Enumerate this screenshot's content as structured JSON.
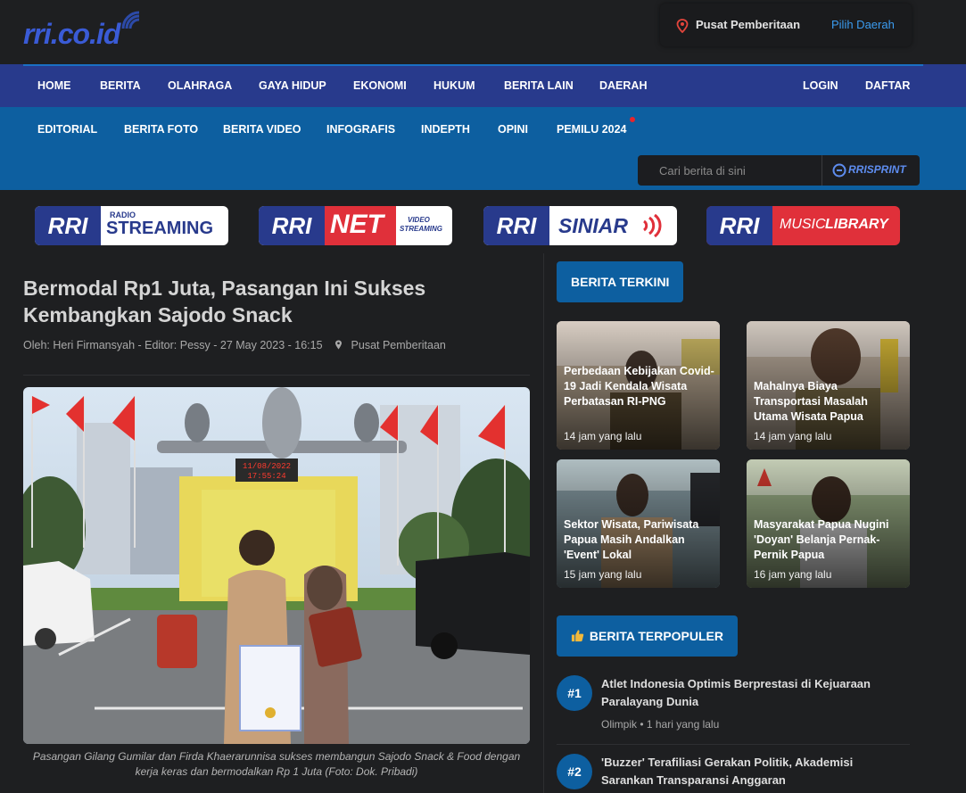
{
  "logo": {
    "text": "rri.co.id"
  },
  "region": {
    "label": "Pusat Pemberitaan",
    "pick": "Pilih Daerah"
  },
  "nav_primary": [
    "HOME",
    "BERITA",
    "OLAHRAGA",
    "GAYA HIDUP",
    "EKONOMI",
    "HUKUM",
    "BERITA LAIN",
    "DAERAH"
  ],
  "nav_account": {
    "login": "LOGIN",
    "register": "DAFTAR"
  },
  "nav_secondary": [
    "EDITORIAL",
    "BERITA FOTO",
    "BERITA VIDEO",
    "INFOGRAFIS",
    "INDEPTH",
    "OPINI",
    "PEMILU 2024"
  ],
  "search": {
    "placeholder": "Cari berita di sini",
    "sprint_label": "RRISPRINT"
  },
  "banners": [
    {
      "brand": "RRI",
      "small": "RADIO",
      "main": "STREAMING"
    },
    {
      "brand": "RRI",
      "main": "NET",
      "small1": "VIDEO",
      "small2": "STREAMING"
    },
    {
      "brand": "RRI",
      "main": "SINIAR"
    },
    {
      "brand": "RRI",
      "main_a": "MUSIC",
      "main_b": "LIBRARY"
    }
  ],
  "article": {
    "title": "Bermodal Rp1 Juta, Pasangan Ini Sukses Kembangkan Sajodo Snack",
    "byline": "Oleh: Heri Firmansyah - Editor: Pessy - 27 May 2023 - 16:15",
    "location": "Pusat Pemberitaan",
    "photo_sign_date": "11/08/2022",
    "photo_sign_time": "17:55:24",
    "caption": "Pasangan Gilang Gumilar dan Firda Khaerarunnisa sukses membangun Sajodo Snack & Food dengan kerja keras dan bermodalkan Rp 1 Juta (Foto: Dok. Pribadi)"
  },
  "latest": {
    "heading": "BERITA TERKINI",
    "items": [
      {
        "title": "Perbedaan Kebijakan Covid-19 Jadi Kendala Wisata Perbatasan RI-PNG",
        "time": "14 jam yang lalu"
      },
      {
        "title": "Mahalnya Biaya Transportasi Masalah Utama Wisata Papua",
        "time": "14 jam yang lalu"
      },
      {
        "title": "Sektor Wisata, Pariwisata Papua Masih Andalkan 'Event' Lokal",
        "time": "15 jam yang lalu"
      },
      {
        "title": "Masyarakat Papua Nugini 'Doyan' Belanja Pernak-Pernik Papua",
        "time": "16 jam yang lalu"
      }
    ]
  },
  "popular": {
    "heading": "BERITA TERPOPULER",
    "items": [
      {
        "rank": "#1",
        "title": "Atlet Indonesia Optimis Berprestasi di Kejuaraan Paralayang Dunia",
        "meta": "Olimpik • 1 hari yang lalu"
      },
      {
        "rank": "#2",
        "title": "'Buzzer' Terafiliasi Gerakan Politik, Akademisi Sarankan Transparansi Anggaran",
        "meta": ""
      }
    ]
  },
  "colors": {
    "nav_primary": "#283a8c",
    "nav_secondary": "#0d5fa0",
    "background": "#1e1f21",
    "link": "#3b9cf0"
  }
}
